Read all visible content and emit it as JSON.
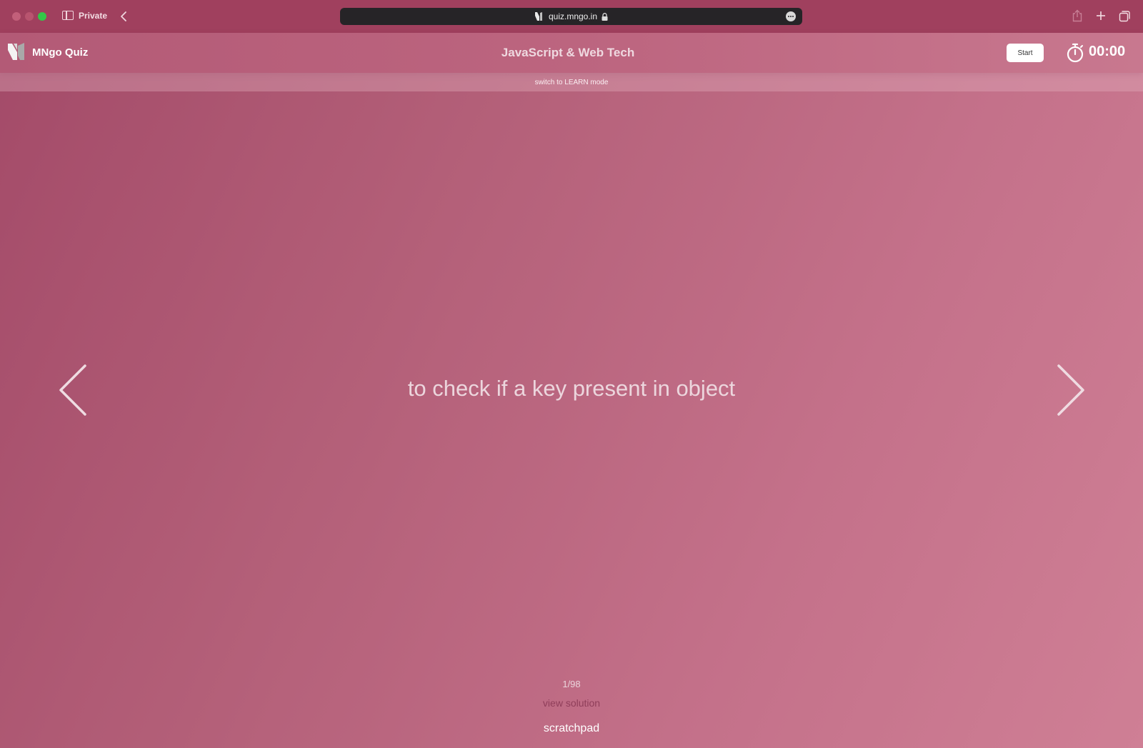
{
  "browser": {
    "private_label": "Private",
    "url": "quiz.mngo.in"
  },
  "header": {
    "brand": "MNgo Quiz",
    "title": "JavaScript & Web Tech",
    "start_label": "Start",
    "timer": "00:00"
  },
  "mode_switch": {
    "label": "switch to LEARN mode"
  },
  "card": {
    "question": "to check if a key present in object",
    "counter": "1/98",
    "view_solution_label": "view solution",
    "scratchpad_label": "scratchpad"
  },
  "icons": {
    "sidebar": "sidebar-icon",
    "back": "chevron-left-icon",
    "lock": "lock-icon",
    "more": "ellipsis-icon",
    "share": "share-icon",
    "new_tab": "plus-icon",
    "tabs": "tab-overview-icon",
    "timer": "stopwatch-icon",
    "prev": "chevron-left-icon",
    "next": "chevron-right-icon"
  },
  "colors": {
    "chrome_bg": "#a0405e",
    "address_bar_bg": "#262427",
    "page_gradient_start": "#a34a68",
    "page_gradient_end": "#cf7f95",
    "view_solution": "#8f3e5a"
  }
}
